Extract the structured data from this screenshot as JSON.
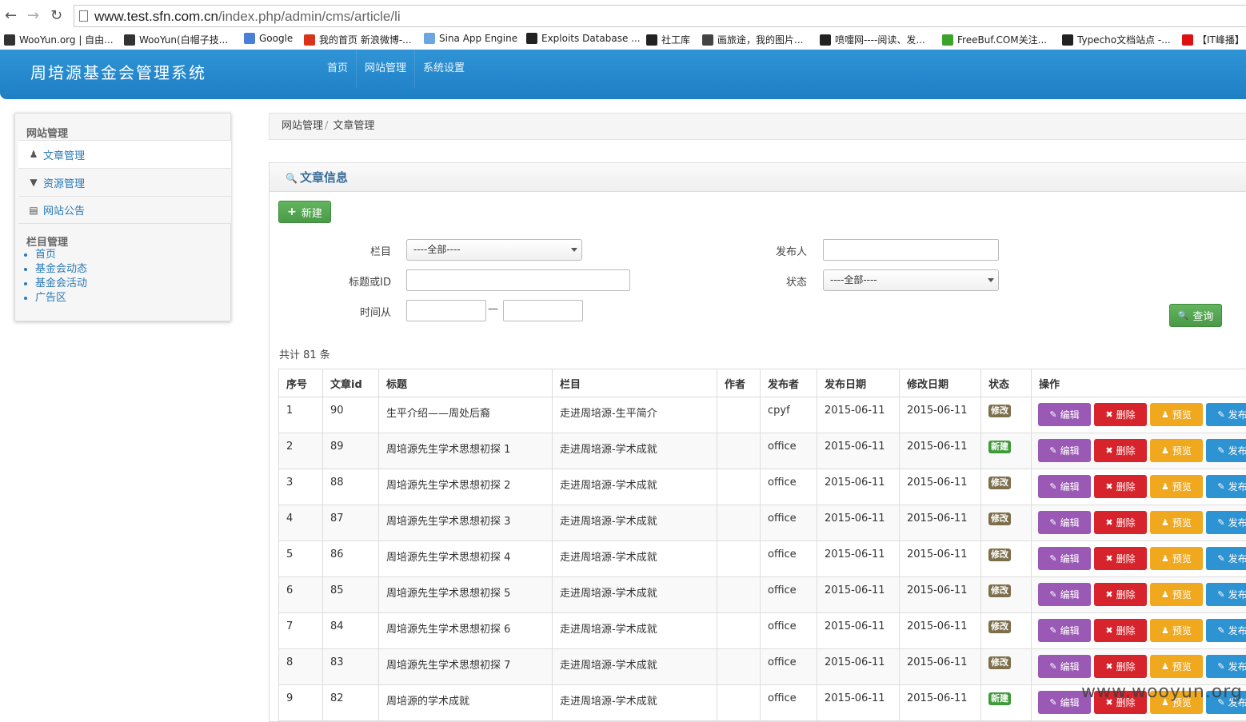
{
  "browser": {
    "url_host": "www.test.sfn.com.cn",
    "url_path": "/index.php/admin/cms/article/li",
    "bookmarks": [
      {
        "label": "WooYun.org | 自由...",
        "icon": "wooyun-icon",
        "color": "#333"
      },
      {
        "label": "WooYun(白帽子技...",
        "icon": "wooyun-icon",
        "color": "#333"
      },
      {
        "label": "Google",
        "icon": "google-icon",
        "color": "#4a7fd8"
      },
      {
        "label": "我的首页 新浪微博-...",
        "icon": "weibo-icon",
        "color": "#d9331b"
      },
      {
        "label": "Sina App Engine",
        "icon": "cloud-icon",
        "color": "#6aa7e0"
      },
      {
        "label": "Exploits Database ...",
        "icon": "exploitdb-icon",
        "color": "#222"
      },
      {
        "label": "社工库",
        "icon": "doc-icon",
        "color": "#222"
      },
      {
        "label": "画旅途，我的图片...",
        "icon": "picture-icon",
        "color": "#444"
      },
      {
        "label": "喷嚏网----阅读、发...",
        "icon": "person-icon",
        "color": "#222"
      },
      {
        "label": "FreeBuf.COM关注...",
        "icon": "freebuf-icon",
        "color": "#3aa32a"
      },
      {
        "label": "Typecho文档站点 -...",
        "icon": "typecho-icon",
        "color": "#222"
      },
      {
        "label": "【IT峰播】",
        "icon": "star-icon",
        "color": "#d11"
      }
    ]
  },
  "header": {
    "brand": "周培源基金会管理系统",
    "nav": [
      "首页",
      "网站管理",
      "系统设置"
    ]
  },
  "sidebar": {
    "section1_title": "网站管理",
    "items": [
      {
        "label": "文章管理",
        "icon": "user-icon"
      },
      {
        "label": "资源管理",
        "icon": "filter-icon"
      },
      {
        "label": "网站公告",
        "icon": "list-icon"
      }
    ],
    "section2_title": "栏目管理",
    "links": [
      "首页",
      "基金会动态",
      "基金会活动",
      "广告区"
    ]
  },
  "breadcrumb": {
    "parent": "网站管理",
    "sep": "/",
    "current": "文章管理"
  },
  "panel": {
    "title": "文章信息",
    "new_button": "新建",
    "query_button": "查询",
    "filters": {
      "column_label": "栏目",
      "column_value": "----全部----",
      "publisher_label": "发布人",
      "publisher_value": "",
      "title_label": "标题或ID",
      "title_value": "",
      "status_label": "状态",
      "status_value": "----全部----",
      "time_label": "时间从",
      "time_from": "",
      "time_to": "",
      "time_sep": "—"
    },
    "total": "共计 81 条"
  },
  "table": {
    "headers": [
      "序号",
      "文章id",
      "标题",
      "栏目",
      "作者",
      "发布者",
      "发布日期",
      "修改日期",
      "状态",
      "操作"
    ],
    "rows": [
      {
        "no": "1",
        "id": "90",
        "title": "生平介绍——周处后裔",
        "column": "走进周培源-生平简介",
        "author": "",
        "publisher": "cpyf",
        "pub_date": "2015-06-11",
        "mod_date": "2015-06-11",
        "status": "修改"
      },
      {
        "no": "2",
        "id": "89",
        "title": "周培源先生学术思想初探 1",
        "column": "走进周培源-学术成就",
        "author": "",
        "publisher": "office",
        "pub_date": "2015-06-11",
        "mod_date": "2015-06-11",
        "status": "新建"
      },
      {
        "no": "3",
        "id": "88",
        "title": "周培源先生学术思想初探 2",
        "column": "走进周培源-学术成就",
        "author": "",
        "publisher": "office",
        "pub_date": "2015-06-11",
        "mod_date": "2015-06-11",
        "status": "修改"
      },
      {
        "no": "4",
        "id": "87",
        "title": "周培源先生学术思想初探 3",
        "column": "走进周培源-学术成就",
        "author": "",
        "publisher": "office",
        "pub_date": "2015-06-11",
        "mod_date": "2015-06-11",
        "status": "修改"
      },
      {
        "no": "5",
        "id": "86",
        "title": "周培源先生学术思想初探 4",
        "column": "走进周培源-学术成就",
        "author": "",
        "publisher": "office",
        "pub_date": "2015-06-11",
        "mod_date": "2015-06-11",
        "status": "修改"
      },
      {
        "no": "6",
        "id": "85",
        "title": "周培源先生学术思想初探 5",
        "column": "走进周培源-学术成就",
        "author": "",
        "publisher": "office",
        "pub_date": "2015-06-11",
        "mod_date": "2015-06-11",
        "status": "修改"
      },
      {
        "no": "7",
        "id": "84",
        "title": "周培源先生学术思想初探 6",
        "column": "走进周培源-学术成就",
        "author": "",
        "publisher": "office",
        "pub_date": "2015-06-11",
        "mod_date": "2015-06-11",
        "status": "修改"
      },
      {
        "no": "8",
        "id": "83",
        "title": "周培源先生学术思想初探 7",
        "column": "走进周培源-学术成就",
        "author": "",
        "publisher": "office",
        "pub_date": "2015-06-11",
        "mod_date": "2015-06-11",
        "status": "修改"
      },
      {
        "no": "9",
        "id": "82",
        "title": "周培源的学术成就",
        "column": "走进周培源-学术成就",
        "author": "",
        "publisher": "office",
        "pub_date": "2015-06-11",
        "mod_date": "2015-06-11",
        "status": "新建"
      }
    ],
    "actions": [
      {
        "label": "编辑",
        "icon": "edit-icon",
        "color": "#9b59b6"
      },
      {
        "label": "删除",
        "icon": "trash-icon",
        "color": "#d6232c"
      },
      {
        "label": "预览",
        "icon": "user-icon",
        "color": "#f0a81e"
      },
      {
        "label": "发布",
        "icon": "edit-icon",
        "color": "#2e93d3"
      }
    ],
    "status_colors": {
      "修改": "#7d6f4c",
      "新建": "#3f9a3a"
    }
  },
  "watermark": "www.wooyun.org"
}
